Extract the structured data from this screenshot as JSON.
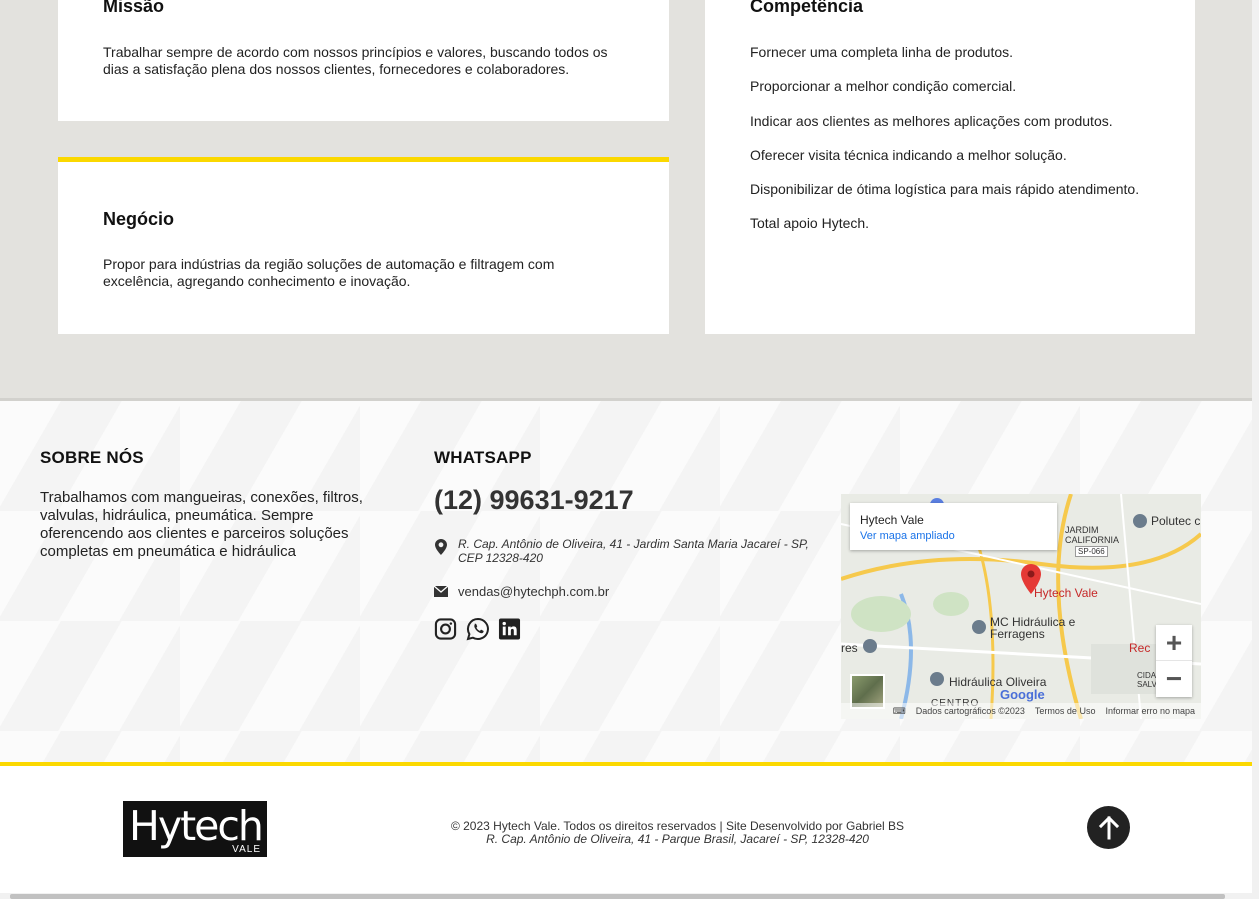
{
  "cards": {
    "missao": {
      "title": "Missão",
      "text": "Trabalhar sempre de acordo com nossos princípios e valores, buscando todos os dias a satisfação plena dos nossos clientes, fornecedores e colaboradores."
    },
    "negocio": {
      "title": "Negócio",
      "text": "Propor para indústrias da região soluções de automação e filtragem com excelência, agregando conhecimento e inovação."
    },
    "competencia": {
      "title": "Competência",
      "items": [
        "Fornecer uma completa linha de produtos.",
        "Proporcionar a melhor condição comercial.",
        "Indicar aos clientes as melhores aplicações com produtos.",
        "Oferecer visita técnica indicando a melhor solução.",
        "Disponibilizar de ótima logística para mais rápido atendimento.",
        "Total apoio Hytech."
      ]
    }
  },
  "footer": {
    "about_title": "SOBRE NÓS",
    "about_text": "Trabalhamos com mangueiras, conexões, filtros, valvulas, hidráulica, pneumática. Sempre oferencendo aos clientes e parceiros soluções completas em pneumática e hidráulica",
    "whatsapp_title": "WHATSAPP",
    "phone": "(12) 99631-9217",
    "address": "R. Cap. Antônio de Oliveira, 41 - Jardim Santa Maria Jacareí - SP, CEP 12328-420",
    "email": "vendas@hytechph.com.br",
    "social_icons": [
      "instagram-icon",
      "whatsapp-icon",
      "linkedin-icon"
    ]
  },
  "map": {
    "place_name": "Hytech Vale",
    "enlarge_link": "Ver mapa ampliado",
    "labels": {
      "marker": "Hytech Vale",
      "jardim": "JARDIM CALIFORNIA",
      "polutec": "Polutec c",
      "mc": "MC Hidráulica e Ferragens",
      "oliveira": "Hidráulica Oliveira",
      "road": "SP-066",
      "rec": "Rec",
      "res": "res",
      "cidade": "CIDADE SALVADO",
      "centro": "CENTRO"
    },
    "zoom_in": "+",
    "zoom_out": "−",
    "brand": "Google",
    "attribution": "Dados cartográficos ©2023",
    "terms": "Termos de Uso",
    "report": "Informar erro no mapa"
  },
  "bottom": {
    "logo_text": "Hytech",
    "logo_sub": "VALE",
    "copyright": "© 2023 Hytech Vale. Todos os direitos reservados | Site Desenvolvido por Gabriel BS",
    "address": "R. Cap. Antônio de Oliveira, 41 - Parque Brasil, Jacareí - SP, 12328-420"
  },
  "colors": {
    "accent": "#fbd800",
    "section_bg": "#e3e2de",
    "dark": "#222222"
  }
}
